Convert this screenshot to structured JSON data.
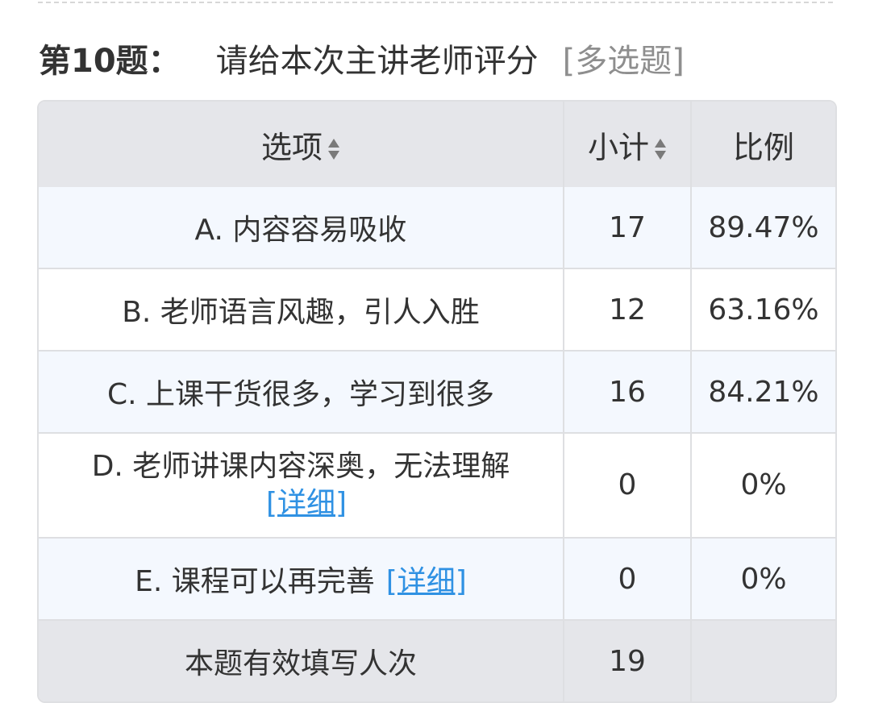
{
  "question": {
    "number": "第10题：",
    "text": "请给本次主讲老师评分",
    "type": "[多选题]"
  },
  "table": {
    "headers": {
      "option": "选项",
      "count": "小计",
      "ratio": "比例"
    },
    "rows": [
      {
        "label": "A. 内容容易吸收",
        "count": "17",
        "ratio": "89.47%",
        "detail": ""
      },
      {
        "label": "B. 老师语言风趣，引人入胜",
        "count": "12",
        "ratio": "63.16%",
        "detail": ""
      },
      {
        "label": "C. 上课干货很多，学习到很多",
        "count": "16",
        "ratio": "84.21%",
        "detail": ""
      },
      {
        "label": "D. 老师讲课内容深奥，无法理解",
        "count": "0",
        "ratio": "0%",
        "detail": "[详细]"
      },
      {
        "label": "E. 课程可以再完善",
        "count": "0",
        "ratio": "0%",
        "detail": "[详细]"
      }
    ],
    "footer": {
      "label": "本题有效填写人次",
      "count": "19",
      "ratio": ""
    }
  },
  "colors": {
    "header_bg": "#e5e6ea",
    "odd_row_bg": "#f4f8fe",
    "link": "#2f91e3",
    "border": "#dedfe2"
  }
}
